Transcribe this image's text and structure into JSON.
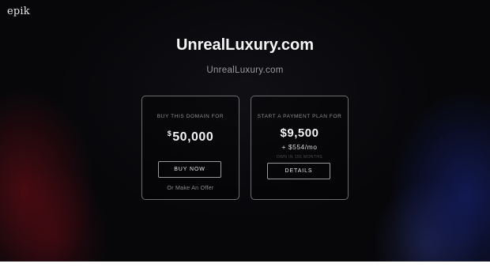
{
  "brand": {
    "logo_text": "epik"
  },
  "header": {
    "title": "UnrealLuxury.com",
    "subtitle": "UnrealLuxury.com"
  },
  "buy_card": {
    "label": "BUY THIS DOMAIN FOR",
    "currency": "$",
    "price": "50,000",
    "button_label": "BUY NOW",
    "offer_link": "Or Make An Offer"
  },
  "plan_card": {
    "label": "START A PAYMENT PLAN FOR",
    "price": "$9,500",
    "monthly": "+ $554/mo",
    "own_note": "OWN IN 156 MONTHS",
    "button_label": "DETAILS"
  },
  "colors": {
    "background": "#07070a",
    "glow_left": "#780e16",
    "glow_right": "#182682",
    "card_border": "#6e6e6e",
    "text_primary": "#f5f5f5",
    "text_muted": "#8c8c8c"
  }
}
